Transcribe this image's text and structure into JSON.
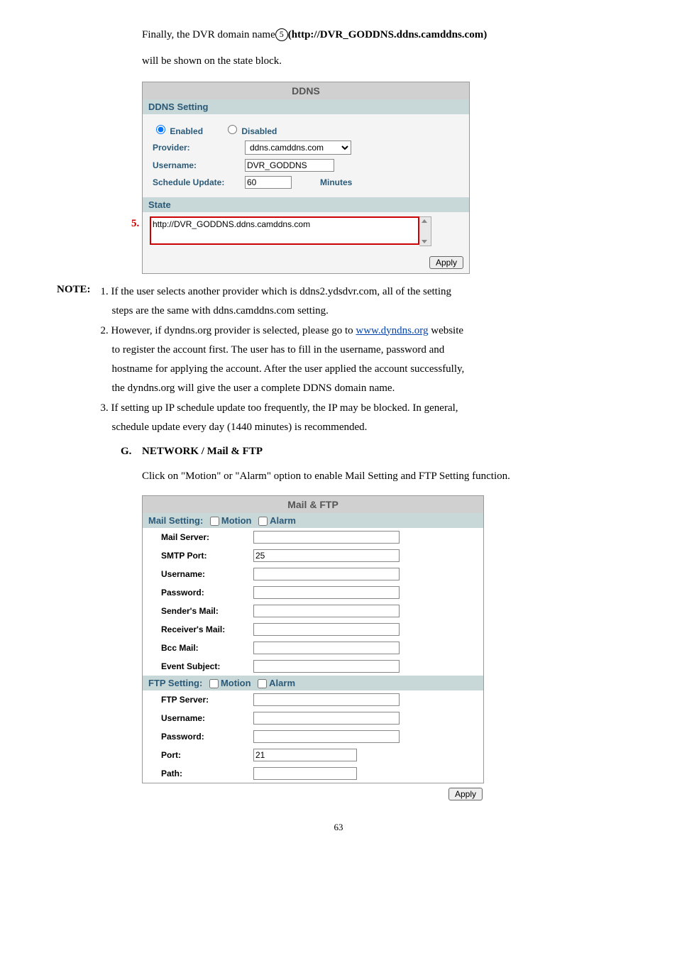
{
  "intro": {
    "text_prefix": "Finally, the DVR domain name",
    "circled": "5",
    "text_suffix": "(http://DVR_GODDNS.ddns.camddns.com)",
    "second_line": "will be shown on the state block."
  },
  "ddns": {
    "title": "DDNS",
    "setting_header": "DDNS Setting",
    "enabled_label": "Enabled",
    "disabled_label": "Disabled",
    "provider_label": "Provider:",
    "provider_value": "ddns.camddns.com",
    "username_label": "Username:",
    "username_value": "DVR_GODDNS",
    "schedule_label": "Schedule Update:",
    "schedule_value": "60",
    "minutes_label": "Minutes",
    "state_header": "State",
    "marker5": "5.",
    "state_value": "http://DVR_GODDNS.ddns.camddns.com",
    "apply_label": "Apply"
  },
  "note": {
    "label": "NOTE:",
    "item1_line1": "1. If the user selects another provider which is ddns2.ydsdvr.com, all of the setting",
    "item1_line2": "steps are the same with ddns.camddns.com setting.",
    "item2_line1a": "2. However, if dyndns.org provider is selected, please go to ",
    "item2_link_text": "www.dyndns.org",
    "item2_line1b": " website",
    "item2_line2": "to register the account first. The user has to fill in the username, password and",
    "item2_line3": "hostname for applying the account. After the user applied the account successfully,",
    "item2_line4": "the dyndns.org will give the user a complete DDNS domain name.",
    "item3_line1": "3. If setting up IP schedule update too frequently, the IP may be blocked. In general,",
    "item3_line2": "schedule update every day (1440 minutes) is recommended."
  },
  "sectionG": {
    "letter": "G.",
    "title": "NETWORK / Mail & FTP",
    "body": "Click on \"Motion\" or \"Alarm\" option to enable Mail Setting and FTP Setting function."
  },
  "mailftp": {
    "title": "Mail & FTP",
    "mail_header_prefix": "Mail Setting: ",
    "ftp_header_prefix": "FTP Setting: ",
    "motion_label": "Motion",
    "alarm_label": "Alarm",
    "mail_server_label": "Mail Server:",
    "smtp_port_label": "SMTP Port:",
    "smtp_port_value": "25",
    "username_label": "Username:",
    "password_label": "Password:",
    "senders_mail_label": "Sender's Mail:",
    "receivers_mail_label": "Receiver's Mail:",
    "bcc_mail_label": "Bcc Mail:",
    "event_subject_label": "Event Subject:",
    "ftp_server_label": "FTP Server:",
    "port_label": "Port:",
    "port_value": "21",
    "path_label": "Path:",
    "apply_label": "Apply"
  },
  "page_num": "63"
}
